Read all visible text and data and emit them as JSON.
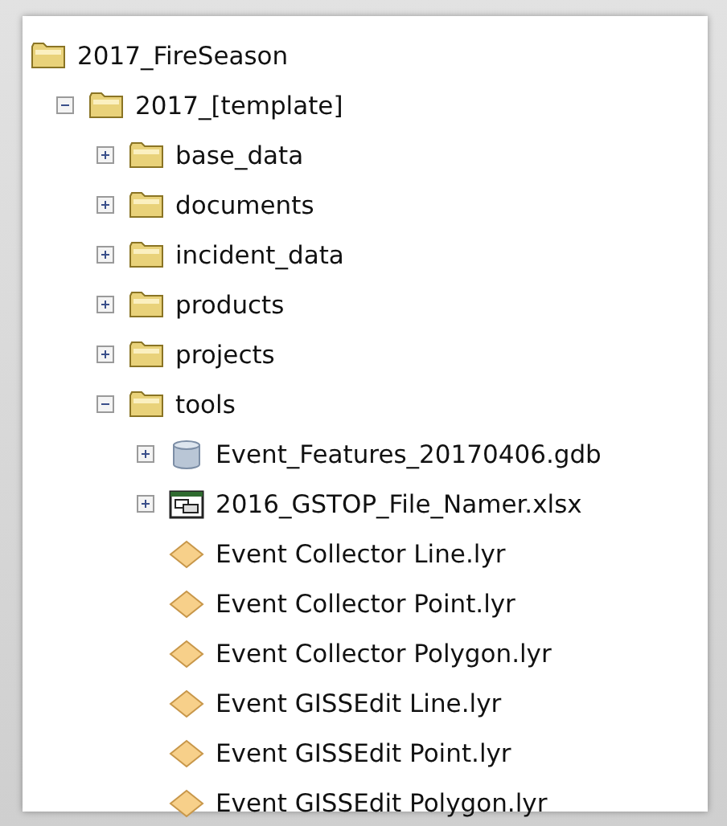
{
  "tree": [
    {
      "label": "2017_FireSeason",
      "kind": "folder",
      "children": [
        {
          "label": "2017_[template]",
          "kind": "folder",
          "expanded": true,
          "children": [
            {
              "label": "base_data",
              "kind": "folder",
              "expanded": false
            },
            {
              "label": "documents",
              "kind": "folder",
              "expanded": false
            },
            {
              "label": "incident_data",
              "kind": "folder",
              "expanded": false
            },
            {
              "label": "products",
              "kind": "folder",
              "expanded": false
            },
            {
              "label": "projects",
              "kind": "folder",
              "expanded": false
            },
            {
              "label": "tools",
              "kind": "folder",
              "expanded": true,
              "children": [
                {
                  "label": "Event_Features_20170406.gdb",
                  "kind": "database",
                  "expanded": false
                },
                {
                  "label": "2016_GSTOP_File_Namer.xlsx",
                  "kind": "spreadsheet",
                  "expanded": false
                },
                {
                  "label": "Event Collector Line.lyr",
                  "kind": "layer"
                },
                {
                  "label": "Event Collector Point.lyr",
                  "kind": "layer"
                },
                {
                  "label": "Event Collector Polygon.lyr",
                  "kind": "layer"
                },
                {
                  "label": "Event GISSEdit Line.lyr",
                  "kind": "layer"
                },
                {
                  "label": "Event GISSEdit Point.lyr",
                  "kind": "layer"
                },
                {
                  "label": "Event GISSEdit Polygon.lyr",
                  "kind": "layer"
                }
              ]
            }
          ]
        }
      ]
    }
  ]
}
